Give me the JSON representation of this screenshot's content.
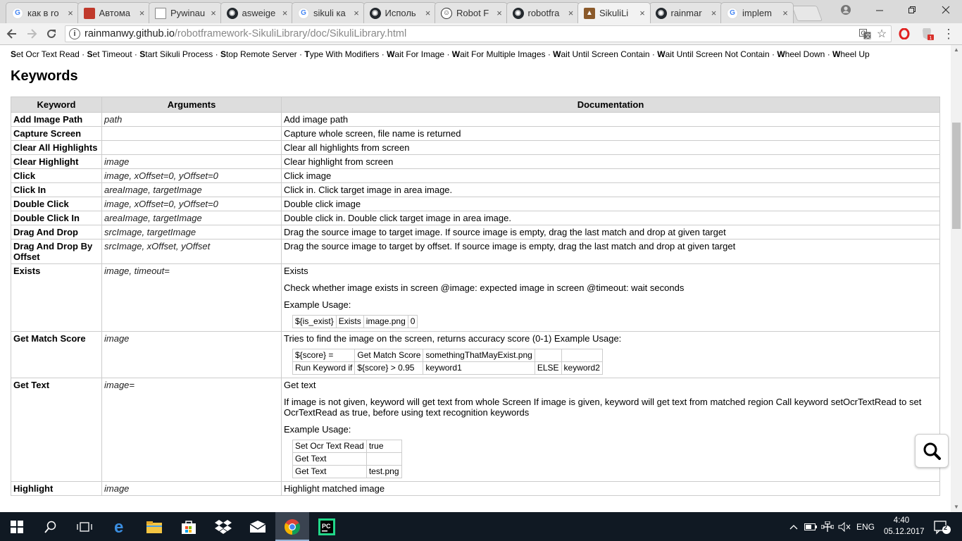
{
  "browser": {
    "tabs": [
      {
        "label": "как в ro",
        "icon": "google-icon",
        "active": false
      },
      {
        "label": "Автома",
        "icon": "bookmark-red-icon",
        "active": false
      },
      {
        "label": "Pywinau",
        "icon": "document-icon",
        "active": false
      },
      {
        "label": "asweige",
        "icon": "github-icon",
        "active": false
      },
      {
        "label": "sikuli ка",
        "icon": "google-icon",
        "active": false
      },
      {
        "label": "Исполь",
        "icon": "github-icon",
        "active": false
      },
      {
        "label": "Robot F",
        "icon": "robot-icon",
        "active": false
      },
      {
        "label": "robotfra",
        "icon": "github-icon",
        "active": false
      },
      {
        "label": "SikuliLi",
        "icon": "sikuli-icon",
        "active": true
      },
      {
        "label": "rainmar",
        "icon": "github-icon",
        "active": false
      },
      {
        "label": "implem",
        "icon": "google-icon",
        "active": false
      }
    ],
    "url_host": "rainmanwy.github.io",
    "url_path": "/robotframework-SikuliLibrary/doc/SikuliLibrary.html",
    "colors": {
      "github": "#24292e",
      "opera": "#e0201f",
      "google_blue": "#4285f4",
      "close_red": "#e81123"
    }
  },
  "shortcuts": [
    "Set Ocr Text Read",
    "Set Timeout",
    "Start Sikuli Process",
    "Stop Remote Server",
    "Type With Modifiers",
    "Wait For Image",
    "Wait For Multiple Images",
    "Wait Until Screen Contain",
    "Wait Until Screen Not Contain",
    "Wheel Down",
    "Wheel Up"
  ],
  "section_title": "Keywords",
  "table": {
    "headers": [
      "Keyword",
      "Arguments",
      "Documentation"
    ],
    "rows": [
      {
        "kw": "Add Image Path",
        "args": "path",
        "doc": [
          "Add image path"
        ]
      },
      {
        "kw": "Capture Screen",
        "args": "",
        "doc": [
          "Capture whole screen, file name is returned"
        ]
      },
      {
        "kw": "Clear All Highlights",
        "args": "",
        "doc": [
          "Clear all highlights from screen"
        ]
      },
      {
        "kw": "Clear Highlight",
        "args": "image",
        "doc": [
          "Clear highlight from screen"
        ]
      },
      {
        "kw": "Click",
        "args": "image, xOffset=0, yOffset=0",
        "doc": [
          "Click image"
        ]
      },
      {
        "kw": "Click In",
        "args": "areaImage, targetImage",
        "doc": [
          "Click in. Click target image in area image."
        ]
      },
      {
        "kw": "Double Click",
        "args": "image, xOffset=0, yOffset=0",
        "doc": [
          "Double click image"
        ]
      },
      {
        "kw": "Double Click In",
        "args": "areaImage, targetImage",
        "doc": [
          "Double click in. Double click target image in area image."
        ]
      },
      {
        "kw": "Drag And Drop",
        "args": "srcImage, targetImage",
        "doc": [
          "Drag the source image to target image. If source image is empty, drag the last match and drop at given target"
        ]
      },
      {
        "kw": "Drag And Drop By Offset",
        "args": "srcImage, xOffset, yOffset",
        "doc": [
          "Drag the source image to target by offset. If source image is empty, drag the last match and drop at given target"
        ]
      },
      {
        "kw": "Exists",
        "args": "image, timeout=",
        "doc": [
          "Exists",
          "Check whether image exists in screen @image: expected image in screen @timeout: wait seconds",
          "Example Usage:"
        ],
        "example": [
          [
            "${is_exist}",
            "Exists",
            "image.png",
            "0"
          ]
        ]
      },
      {
        "kw": "Get Match Score",
        "args": "image",
        "doc": [
          "Tries to find the image on the screen, returns accuracy score (0-1) Example Usage:"
        ],
        "example": [
          [
            "${score} =",
            "Get Match Score",
            "somethingThatMayExist.png",
            "",
            ""
          ],
          [
            "Run Keyword if",
            "${score} > 0.95",
            "keyword1",
            "ELSE",
            "keyword2"
          ]
        ]
      },
      {
        "kw": "Get Text",
        "args": "image=",
        "doc": [
          "Get text",
          "If image is not given, keyword will get text from whole Screen If image is given, keyword will get text from matched region Call keyword setOcrTextRead to set OcrTextRead as true, before using text recognition keywords",
          "Example Usage:"
        ],
        "example": [
          [
            "Set Ocr Text Read",
            "true"
          ],
          [
            "Get Text",
            ""
          ],
          [
            "Get Text",
            "test.png"
          ]
        ]
      },
      {
        "kw": "Highlight",
        "args": "image",
        "doc": [
          "Highlight matched image"
        ]
      }
    ]
  },
  "taskbar": {
    "language": "ENG",
    "time": "4:40",
    "date": "05.12.2017",
    "notifications": "2"
  }
}
